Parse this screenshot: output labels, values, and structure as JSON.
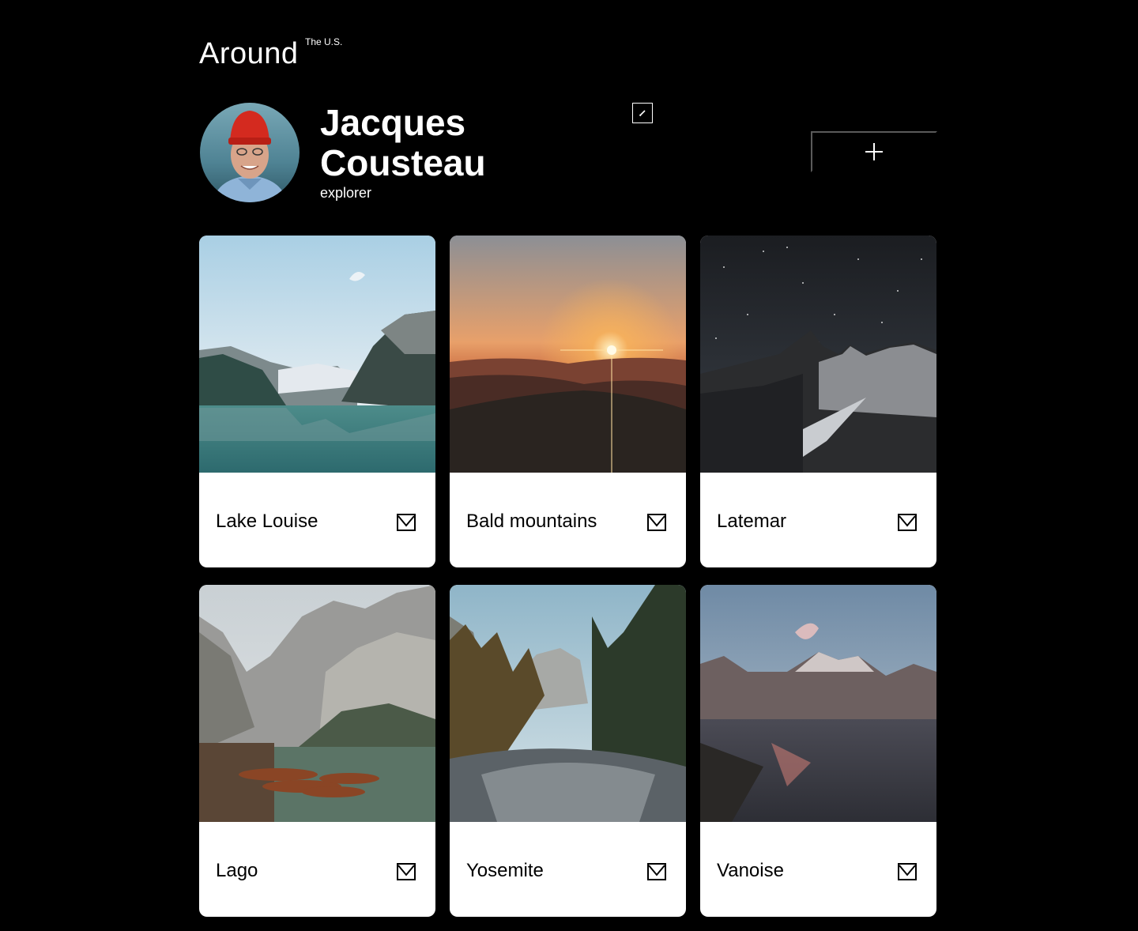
{
  "header": {
    "logo": "Around",
    "logo_sup": "The U.S."
  },
  "profile": {
    "name": "Jacques Cousteau",
    "about": "explorer"
  },
  "icons": {
    "edit": "pencil-icon",
    "add": "plus-icon",
    "like": "heart-icon"
  },
  "cards": [
    {
      "title": "Lake Louise"
    },
    {
      "title": "Bald mountains"
    },
    {
      "title": "Latemar"
    },
    {
      "title": "Lago"
    },
    {
      "title": "Yosemite"
    },
    {
      "title": "Vanoise"
    }
  ]
}
